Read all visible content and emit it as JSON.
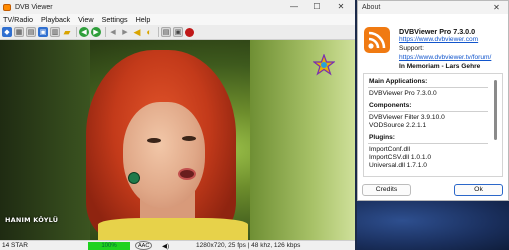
{
  "dvb": {
    "title": "DVB Viewer",
    "menu": [
      "TV/Radio",
      "Playback",
      "View",
      "Settings",
      "Help"
    ],
    "window_controls": {
      "minimize": "—",
      "maximize": "☐",
      "close": "✕"
    },
    "video": {
      "caption": "HANIM KÖYLÜ"
    },
    "status": {
      "channel": "14 STAR",
      "volume": "100%",
      "audio": "AAC",
      "info": "1280x720, 25 fps | 48 khz, 126 kbps"
    }
  },
  "about": {
    "title": "About",
    "close": "✕",
    "product": "DVBViewer Pro   7.3.0.0",
    "website": "https://www.dvbviewer.com",
    "support_label": "Support:",
    "support_link": "https://www.dvbviewer.tv/forum/",
    "memoriam": "In Memoriam - Lars Gehre",
    "sections": {
      "main_header": "Main Applications:",
      "main_items": [
        "DVBViewer Pro    7.3.0.0"
      ],
      "components_header": "Components:",
      "components_items": [
        "DVBViewer Filter   3.9.10.0",
        "VODSource   2.2.1.1"
      ],
      "plugins_header": "Plugins:",
      "plugins_items": [
        "ImportConf.dll",
        "ImportCSV.dll      1.0.1.0",
        "Universal.dll      1.7.1.0"
      ]
    },
    "buttons": {
      "credits": "Credits",
      "ok": "Ok"
    }
  }
}
